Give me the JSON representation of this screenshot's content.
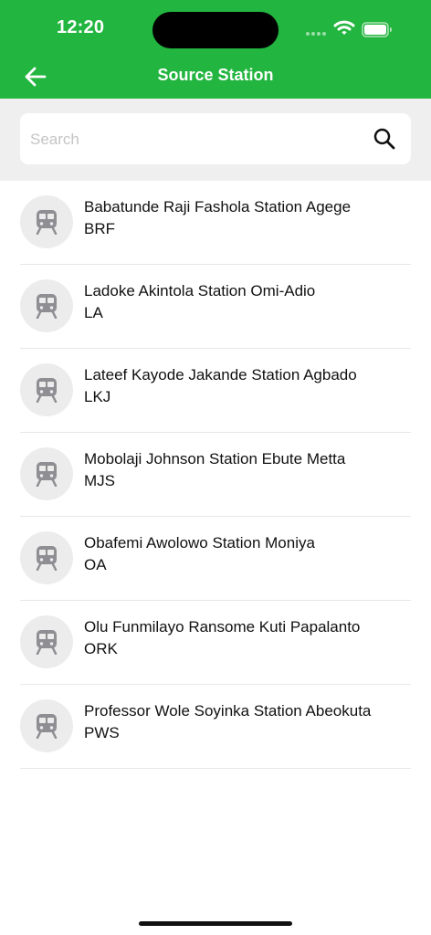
{
  "status_bar": {
    "time": "12:20"
  },
  "header": {
    "title": "Source Station",
    "back_icon": "arrow-left-icon"
  },
  "search": {
    "placeholder": "Search",
    "value": "",
    "icon": "search-icon"
  },
  "stations": [
    {
      "name": "Babatunde Raji Fashola Station Agege",
      "code": "BRF",
      "icon": "train-icon"
    },
    {
      "name": "Ladoke Akintola Station Omi-Adio",
      "code": "LA",
      "icon": "train-icon"
    },
    {
      "name": "Lateef Kayode Jakande Station Agbado",
      "code": "LKJ",
      "icon": "train-icon"
    },
    {
      "name": "Mobolaji Johnson Station Ebute Metta",
      "code": "MJS",
      "icon": "train-icon"
    },
    {
      "name": "Obafemi Awolowo Station Moniya",
      "code": "OA",
      "icon": "train-icon"
    },
    {
      "name": "Olu Funmilayo Ransome Kuti Papalanto",
      "code": "ORK",
      "icon": "train-icon"
    },
    {
      "name": "Professor Wole Soyinka Station Abeokuta",
      "code": "PWS",
      "icon": "train-icon"
    }
  ],
  "colors": {
    "header_green": "#22b53f",
    "search_background": "#efefef",
    "avatar_background": "#ececec",
    "train_icon": "#8e8e93"
  }
}
